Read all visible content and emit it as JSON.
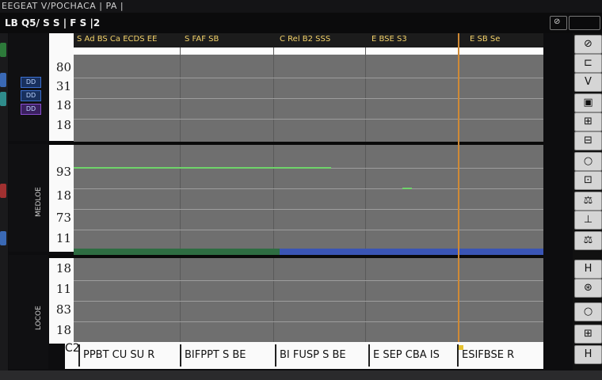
{
  "window": {
    "title": "EEGEAT V/POCHACA | PA |",
    "menu_label": "LB Q5/ S S | F S |2",
    "control_glyph": "⊘"
  },
  "lanes": [
    {
      "label": "",
      "ticks": [
        "80",
        "31",
        "18",
        "18"
      ]
    },
    {
      "label": "MEDLOE",
      "ticks": [
        "93",
        "18",
        "73",
        "11"
      ]
    },
    {
      "label": "LOCOE",
      "ticks": [
        "18",
        "11",
        "83",
        "18"
      ]
    }
  ],
  "lane_buttons": [
    "DD",
    "DD",
    "DD"
  ],
  "column_headers": [
    "S Ad BS Ca ECDS EE",
    "S FAF SB",
    "C Rel B2 SSS",
    "E BSE S3",
    "E SB Se"
  ],
  "footer_start": "C2",
  "footer_cells": [
    "PPBT CU SU R",
    "BIFPPT S BE",
    "BI FUSP S BE",
    "E SEP CBA IS",
    "ESIFBSE R"
  ],
  "tools": [
    "⊘",
    "⊏",
    "V",
    "▣",
    "⊞",
    "⊟",
    "○",
    "⊡",
    "⚖",
    "⊥",
    "⚖",
    "H",
    "⊛",
    "○",
    "⊞",
    "H"
  ],
  "accent_colors": {
    "playhead": "#d08a35",
    "trace_green": "#6fd46a",
    "band_blue": "#3a55b5",
    "header_text": "#f4d36a"
  }
}
